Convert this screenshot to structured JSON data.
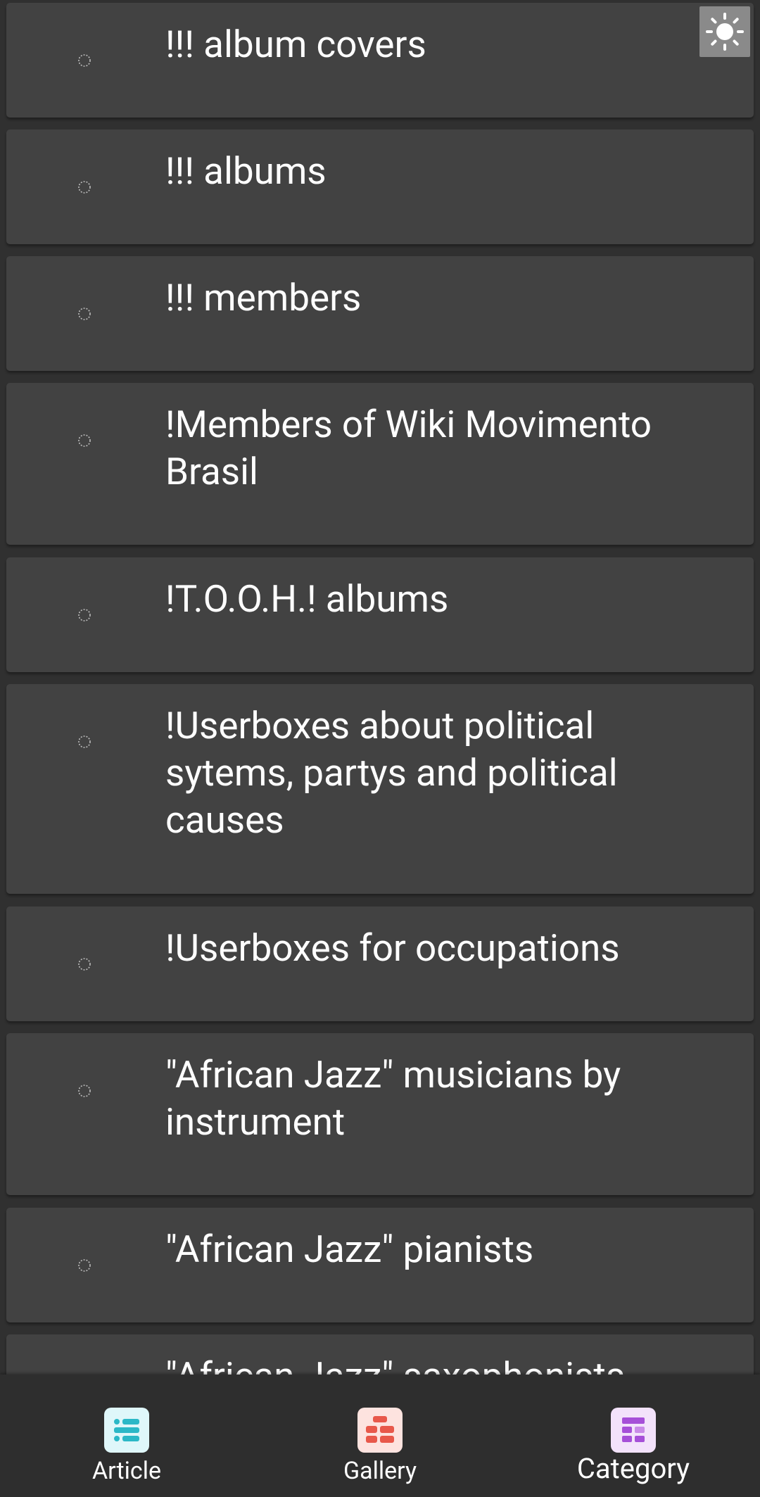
{
  "list": {
    "items": [
      {
        "title": "!!! album covers"
      },
      {
        "title": "!!! albums"
      },
      {
        "title": "!!! members"
      },
      {
        "title": "!Members of Wiki Movimento Brasil"
      },
      {
        "title": "!T.O.O.H.! albums"
      },
      {
        "title": "!Userboxes about political sytems, partys and political causes"
      },
      {
        "title": "!Userboxes for occupations"
      },
      {
        "title": "\"African Jazz\" musicians by instrument"
      },
      {
        "title": "\"African Jazz\" pianists"
      },
      {
        "title": "\"African Jazz\" saxophonists"
      }
    ]
  },
  "theme_toggle": {
    "icon": "sun-icon"
  },
  "bottom_nav": {
    "items": [
      {
        "label": "Article",
        "icon": "article-icon",
        "color": "#2bb8c7",
        "bg": "#dff7fa"
      },
      {
        "label": "Gallery",
        "icon": "gallery-icon",
        "color": "#e8584a",
        "bg": "#fde3df"
      },
      {
        "label": "Category",
        "icon": "category-icon",
        "color": "#a64fd8",
        "bg": "#f3e2fb"
      }
    ],
    "selected": "Category"
  }
}
